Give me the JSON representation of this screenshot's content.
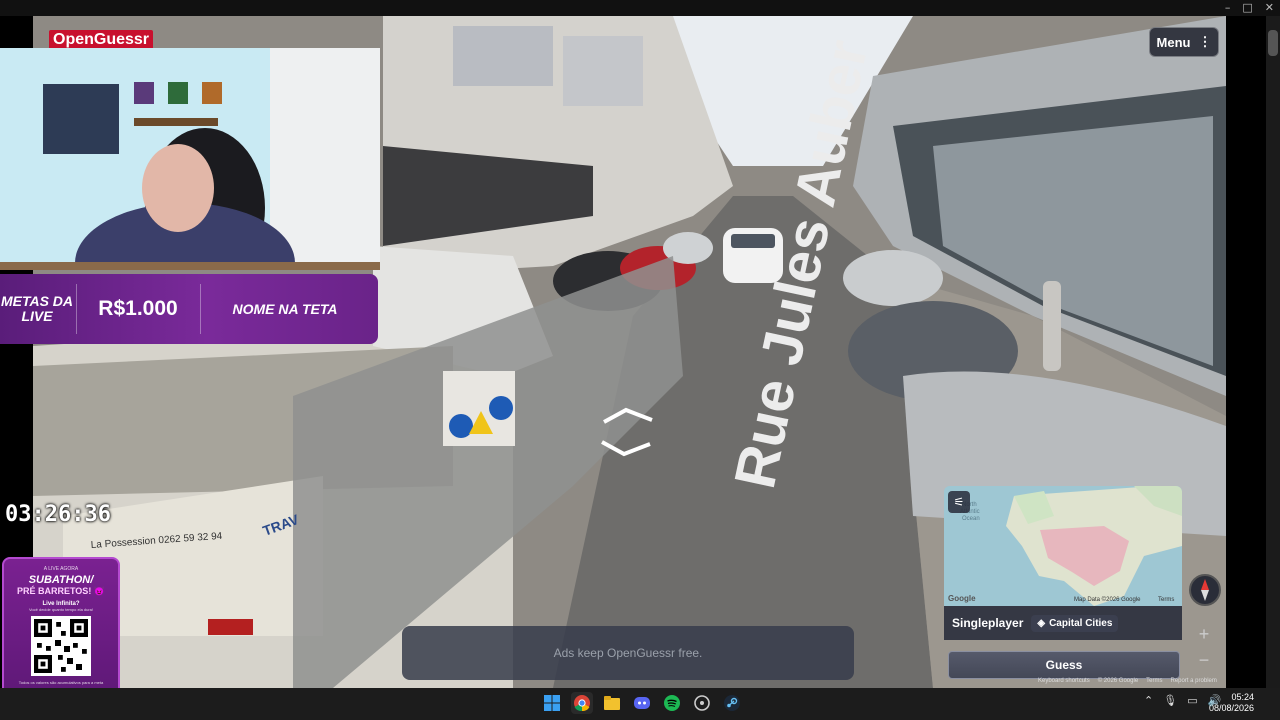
{
  "app": {
    "logo_text": "OpenGuessr",
    "menu_label": "Menu",
    "menu_icon": "⋮"
  },
  "window_controls": {
    "minimize": "–",
    "maximize": "□",
    "close": "✕"
  },
  "street": {
    "road_marking": "Rue Jules Auber",
    "truck_text": "La Possession 0262 59 32 94",
    "truck_side_text": "TRAV"
  },
  "stream": {
    "metas": {
      "label": "METAS DA LIVE",
      "amount": "R$1.000",
      "goal": "NOME NA TETA"
    },
    "timer": "03:26:36",
    "subathon": {
      "live_now": "A LIVE AGORA",
      "title": "SUBATHON/",
      "subtitle": "PRÉ BARRETOS! 😈",
      "infinite": "Live Infinita?",
      "note": "Você decide quanto tempo ela dura!",
      "footer": "Todos os valores são acumulativos para a meta",
      "pix": "PIX: PERFIL DO STREAMER"
    }
  },
  "ads": {
    "text": "Ads keep OpenGuessr free."
  },
  "map": {
    "attribution": "Map Data ©2026 Google",
    "google_logo": "Google",
    "terms": "Terms",
    "mode": "Singleplayer",
    "mode_chip": "Capital Cities",
    "guess_label": "Guess",
    "zoom_in": "+",
    "zoom_out": "−"
  },
  "footer_links": [
    "Keyboard shortcuts",
    "© 2026 Google",
    "Terms",
    "Report a problem"
  ],
  "taskbar": {
    "icons": [
      "windows-start-icon",
      "chrome-icon",
      "file-explorer-icon",
      "discord-icon",
      "spotify-icon",
      "app-icon",
      "steam-icon"
    ],
    "time": "05:24",
    "date": "08/08/2026"
  },
  "colors": {
    "accent_purple": "#7a2a9a",
    "logo_red": "#c8102e",
    "panel": "#2d303e"
  }
}
